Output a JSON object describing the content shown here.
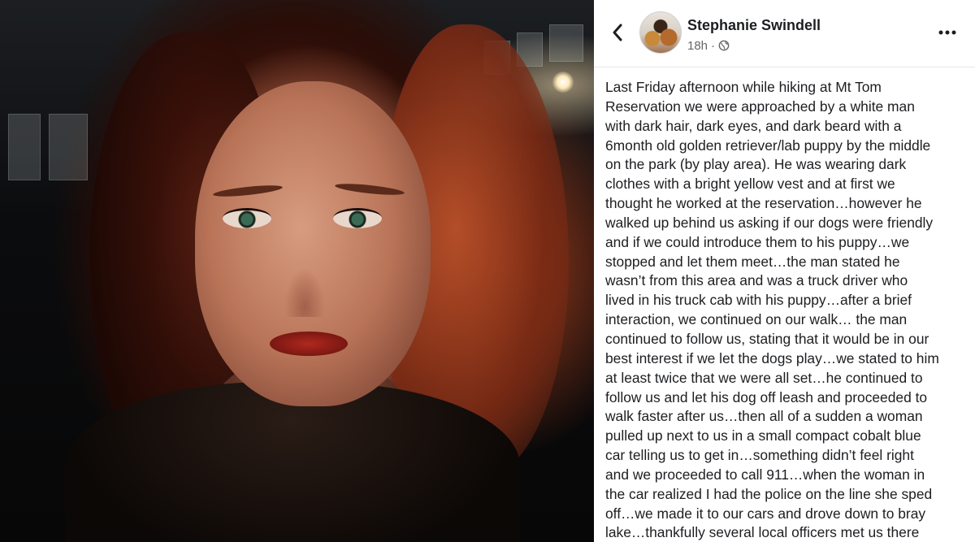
{
  "photo": {
    "alt": ""
  },
  "post": {
    "author": "Stephanie Swindell",
    "time": "18h",
    "separator": "·",
    "icons": {
      "back": "back-arrow-icon",
      "audience": "globe-icon",
      "more": "more-dots-icon"
    },
    "body_lines": [
      "Last Friday afternoon while hiking at Mt Tom",
      "Reservation we were approached by a white man",
      "with dark hair, dark eyes, and dark beard with a",
      "6month old golden retriever/lab puppy by the middle",
      "on the park (by play area). He was wearing dark",
      "clothes with a bright yellow vest and at first we",
      "thought he worked at the reservation…however he",
      "walked up behind us asking if our dogs were friendly",
      "and if we could introduce them to his puppy…we",
      "stopped and let them meet…the man stated he",
      "wasn’t from this area and was a truck driver who",
      "lived in his truck cab with his puppy…after a brief",
      "interaction, we continued on our walk… the man",
      "continued to follow us, stating that it would be in our",
      "best interest if we let the dogs play…we stated to him",
      "at least twice that we were all set…he continued to",
      "follow us and let his dog off leash and proceeded to",
      "walk faster after us…then all of a sudden a woman",
      "pulled up next to us in a small compact cobalt blue",
      "car telling us to get in…something didn’t feel right",
      "and we proceeded to call 911…when the woman in",
      "the car realized I had the police on the line she sped",
      "off…we made it to our cars and drove down to bray",
      "lake…thankfully several local officers met us there"
    ]
  },
  "colors": {
    "name": "#1c1e21",
    "meta": "#65676b",
    "divider": "#e4e6eb"
  }
}
